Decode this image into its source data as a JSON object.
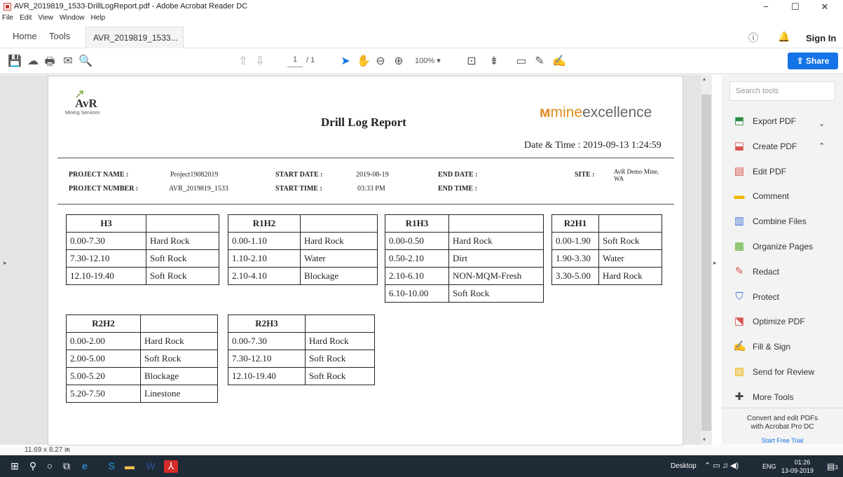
{
  "window": {
    "title": "AVR_2019819_1533-DrillLogReport.pdf - Adobe Acrobat Reader DC",
    "minimize": "−",
    "maximize": "☐",
    "close": "✕"
  },
  "menu": [
    "File",
    "Edit",
    "View",
    "Window",
    "Help"
  ],
  "tabs": {
    "home": "Home",
    "tools": "Tools",
    "doc": "AVR_2019819_1533...",
    "close": "×",
    "sign_in": "Sign In"
  },
  "toolbar": {
    "page_current": "1",
    "page_total": "/ 1",
    "zoom": "100%",
    "share": "Share"
  },
  "report": {
    "logo_left": "AvR",
    "logo_left_sub": "Mining Services",
    "logo_right_a": "mine",
    "logo_right_b": "excellence",
    "title": "Drill Log Report",
    "datetime_label": "Date & Time :",
    "datetime_value": "2019-09-13 1:24:59",
    "project_name_label": "PROJECT NAME :",
    "project_name": "Project19082019",
    "project_number_label": "PROJECT NUMBER :",
    "project_number": "AVR_2019819_1533",
    "start_date_label": "START DATE :",
    "start_date": "2019-08-19",
    "start_time_label": "START TIME :",
    "start_time": "03:33 PM",
    "end_date_label": "END DATE :",
    "end_date": "",
    "end_time_label": "END TIME :",
    "end_time": "",
    "site_label": "SITE :",
    "site": "AvR Demo Mine, WA"
  },
  "holes": [
    {
      "name": "H3",
      "rows": [
        [
          "0.00-7.30",
          "Hard Rock"
        ],
        [
          "7.30-12.10",
          "Soft Rock"
        ],
        [
          "12.10-19.40",
          "Soft Rock"
        ]
      ]
    },
    {
      "name": "R1H2",
      "rows": [
        [
          "0.00-1.10",
          "Hard Rock"
        ],
        [
          "1.10-2.10",
          "Water"
        ],
        [
          "2.10-4.10",
          "Blockage"
        ]
      ]
    },
    {
      "name": "R1H3",
      "rows": [
        [
          "0.00-0.50",
          "Hard Rock"
        ],
        [
          "0.50-2.10",
          "Dirt"
        ],
        [
          "2.10-6.10",
          "NON-MQM-Fresh"
        ],
        [
          "6.10-10.00",
          "Soft Rock"
        ]
      ]
    },
    {
      "name": "R2H1",
      "rows": [
        [
          "0.00-1.90",
          "Soft Rock"
        ],
        [
          "1.90-3.30",
          "Water"
        ],
        [
          "3.30-5.00",
          "Hard Rock"
        ]
      ]
    },
    {
      "name": "R2H2",
      "rows": [
        [
          "0.00-2.00",
          "Hard Rock"
        ],
        [
          "2.00-5.00",
          "Soft Rock"
        ],
        [
          "5.00-5.20",
          "Blockage"
        ],
        [
          "5.20-7.50",
          "Linestone"
        ]
      ]
    },
    {
      "name": "R2H3",
      "rows": [
        [
          "0.00-7.30",
          "Hard Rock"
        ],
        [
          "7.30-12.10",
          "Soft Rock"
        ],
        [
          "12.10-19.40",
          "Soft Rock"
        ]
      ]
    }
  ],
  "right_panel": {
    "search_placeholder": "Search tools",
    "tools": [
      {
        "label": "Export PDF",
        "icon": "export-pdf-icon",
        "color": "#2d8a45"
      },
      {
        "label": "Create PDF",
        "icon": "create-pdf-icon",
        "color": "#d9534f"
      },
      {
        "label": "Edit PDF",
        "icon": "edit-pdf-icon",
        "color": "#d9534f"
      },
      {
        "label": "Comment",
        "icon": "comment-icon",
        "color": "#f0b400"
      },
      {
        "label": "Combine Files",
        "icon": "combine-files-icon",
        "color": "#3a6fd8"
      },
      {
        "label": "Organize Pages",
        "icon": "organize-pages-icon",
        "color": "#58b030"
      },
      {
        "label": "Redact",
        "icon": "redact-icon",
        "color": "#d9534f"
      },
      {
        "label": "Protect",
        "icon": "protect-icon",
        "color": "#3a6fd8"
      },
      {
        "label": "Optimize PDF",
        "icon": "optimize-pdf-icon",
        "color": "#d9534f"
      },
      {
        "label": "Fill & Sign",
        "icon": "fill-sign-icon",
        "color": "#7a53c8"
      },
      {
        "label": "Send for Review",
        "icon": "send-review-icon",
        "color": "#f0b400"
      },
      {
        "label": "More Tools",
        "icon": "more-tools-icon",
        "color": "#444444"
      }
    ],
    "promo_line1": "Convert and edit PDFs",
    "promo_line2": "with Acrobat Pro DC",
    "promo_link": "Start Free Trial"
  },
  "status": {
    "page_size": "11.69 x 8.27 in"
  },
  "taskbar": {
    "desktop": "Desktop",
    "lang": "ENG",
    "time": "01:26",
    "date": "13-09-2019",
    "notif_count": "3"
  }
}
